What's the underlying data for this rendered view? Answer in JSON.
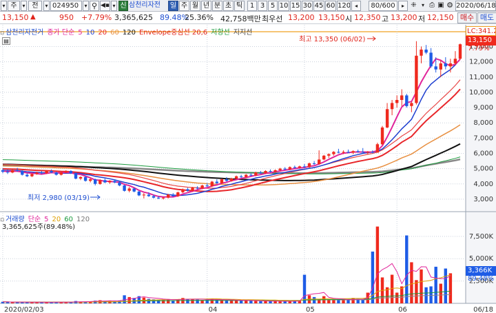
{
  "toolbar": {
    "menu1": "주",
    "menu2": "전",
    "code": "024950",
    "tag": "신",
    "name": "삼천리자전",
    "period": [
      "일",
      "주",
      "월",
      "년",
      "분",
      "초",
      "틱"
    ],
    "ticks": [
      "1",
      "3",
      "5",
      "10",
      "15",
      "30",
      "45",
      "60",
      "120"
    ],
    "count": "80/600",
    "date": "2020/06/18"
  },
  "quote": {
    "price": "13,150",
    "arrow": "▲",
    "change": "950",
    "pct": "+7.79%",
    "volume": "3,365,625",
    "vol_ratio": "89.48%",
    "turnover": "25.36%",
    "amount": "42,758백만",
    "best_label": "최우선",
    "ask": "13,200",
    "bid": "13,150",
    "open_label": "시",
    "open": "12,350",
    "high_label": "고",
    "high": "13,200",
    "low_label": "저",
    "low": "12,150",
    "buy": "매수",
    "sell": "매도"
  },
  "legend": {
    "name": "삼천리자전거",
    "ma_label": "종가 단순",
    "ma": [
      "5",
      "10",
      "20",
      "60",
      "120"
    ],
    "envelope": "Envelope중심선 20,6",
    "resist": "저항선",
    "support": "지지선"
  },
  "price_panel": {
    "lc_label": "LC:341.2",
    "last_price": "13,150",
    "last_pct": "7.79%",
    "high_note": "최고 13,350 (06/02)",
    "low_note": "최저 2,980 (03/19)",
    "ticks": [
      "13,000",
      "12,000",
      "11,000",
      "10,000",
      "9,000",
      "8,000",
      "7,000",
      "6,000",
      "5,000",
      "4,000",
      "3,000"
    ]
  },
  "vol_panel": {
    "title": "거래량",
    "ma_label": "단순",
    "ma": [
      "5",
      "20",
      "60",
      "120"
    ],
    "current": "3,365,625주(89.48%)",
    "ticks": [
      "7,500K",
      "5,000K",
      "2,500K"
    ],
    "last_vol": "3,366K",
    "last_pct": "89.48%"
  },
  "x_axis": {
    "labels": [
      "2020/02/03",
      "04",
      "05",
      "06",
      "06/18"
    ]
  },
  "chart_data": {
    "type": "candlestick",
    "y_range": [
      2500,
      13700
    ],
    "candles": [
      {
        "d": "02/03",
        "o": 4900,
        "h": 5000,
        "l": 4700,
        "c": 4800
      },
      {
        "d": "02/04",
        "o": 4800,
        "h": 4950,
        "l": 4650,
        "c": 4750
      },
      {
        "d": "02/05",
        "o": 4750,
        "h": 4950,
        "l": 4700,
        "c": 4900
      },
      {
        "d": "02/06",
        "o": 4900,
        "h": 5050,
        "l": 4800,
        "c": 4850
      },
      {
        "d": "02/07",
        "o": 4850,
        "h": 4900,
        "l": 4550,
        "c": 4600
      },
      {
        "d": "02/10",
        "o": 4600,
        "h": 4700,
        "l": 4450,
        "c": 4500
      },
      {
        "d": "02/11",
        "o": 4500,
        "h": 4700,
        "l": 4450,
        "c": 4650
      },
      {
        "d": "02/12",
        "o": 4650,
        "h": 4800,
        "l": 4600,
        "c": 4750
      },
      {
        "d": "02/13",
        "o": 4750,
        "h": 4850,
        "l": 4650,
        "c": 4700
      },
      {
        "d": "02/14",
        "o": 4700,
        "h": 4900,
        "l": 4650,
        "c": 4850
      },
      {
        "d": "02/17",
        "o": 4850,
        "h": 4950,
        "l": 4700,
        "c": 4750
      },
      {
        "d": "02/18",
        "o": 4750,
        "h": 4800,
        "l": 4550,
        "c": 4600
      },
      {
        "d": "02/19",
        "o": 4600,
        "h": 4800,
        "l": 4550,
        "c": 4750
      },
      {
        "d": "02/20",
        "o": 4750,
        "h": 4900,
        "l": 4700,
        "c": 4850
      },
      {
        "d": "02/21",
        "o": 4850,
        "h": 4900,
        "l": 4650,
        "c": 4700
      },
      {
        "d": "02/24",
        "o": 4700,
        "h": 4750,
        "l": 4300,
        "c": 4350
      },
      {
        "d": "02/25",
        "o": 4350,
        "h": 4500,
        "l": 4250,
        "c": 4450
      },
      {
        "d": "02/26",
        "o": 4450,
        "h": 4500,
        "l": 4150,
        "c": 4200
      },
      {
        "d": "02/27",
        "o": 4200,
        "h": 4400,
        "l": 4100,
        "c": 4300
      },
      {
        "d": "02/28",
        "o": 4300,
        "h": 4350,
        "l": 3900,
        "c": 4000
      },
      {
        "d": "03/02",
        "o": 4000,
        "h": 4300,
        "l": 3950,
        "c": 4250
      },
      {
        "d": "03/03",
        "o": 4250,
        "h": 4350,
        "l": 4050,
        "c": 4100
      },
      {
        "d": "03/04",
        "o": 4100,
        "h": 4250,
        "l": 4000,
        "c": 4200
      },
      {
        "d": "03/05",
        "o": 4200,
        "h": 4300,
        "l": 4050,
        "c": 4100
      },
      {
        "d": "03/06",
        "o": 4100,
        "h": 4150,
        "l": 3850,
        "c": 3900
      },
      {
        "d": "03/09",
        "o": 3900,
        "h": 3950,
        "l": 3500,
        "c": 3550
      },
      {
        "d": "03/10",
        "o": 3550,
        "h": 3800,
        "l": 3450,
        "c": 3700
      },
      {
        "d": "03/11",
        "o": 3700,
        "h": 3750,
        "l": 3450,
        "c": 3500
      },
      {
        "d": "03/12",
        "o": 3500,
        "h": 3550,
        "l": 3200,
        "c": 3250
      },
      {
        "d": "03/13",
        "o": 3250,
        "h": 3400,
        "l": 3050,
        "c": 3300
      },
      {
        "d": "03/16",
        "o": 3300,
        "h": 3450,
        "l": 3150,
        "c": 3200
      },
      {
        "d": "03/17",
        "o": 3200,
        "h": 3300,
        "l": 3050,
        "c": 3100
      },
      {
        "d": "03/18",
        "o": 3100,
        "h": 3200,
        "l": 3000,
        "c": 3050
      },
      {
        "d": "03/19",
        "o": 3050,
        "h": 3150,
        "l": 2980,
        "c": 3100
      },
      {
        "d": "03/20",
        "o": 3100,
        "h": 3350,
        "l": 3050,
        "c": 3300
      },
      {
        "d": "03/23",
        "o": 3300,
        "h": 3400,
        "l": 3150,
        "c": 3200
      },
      {
        "d": "03/24",
        "o": 3200,
        "h": 3500,
        "l": 3150,
        "c": 3450
      },
      {
        "d": "03/25",
        "o": 3450,
        "h": 3700,
        "l": 3400,
        "c": 3650
      },
      {
        "d": "03/26",
        "o": 3650,
        "h": 3750,
        "l": 3500,
        "c": 3550
      },
      {
        "d": "03/27",
        "o": 3550,
        "h": 3800,
        "l": 3500,
        "c": 3750
      },
      {
        "d": "03/30",
        "o": 3750,
        "h": 3850,
        "l": 3650,
        "c": 3700
      },
      {
        "d": "03/31",
        "o": 3700,
        "h": 3950,
        "l": 3650,
        "c": 3900
      },
      {
        "d": "04/01",
        "o": 3900,
        "h": 4050,
        "l": 3800,
        "c": 3850
      },
      {
        "d": "04/02",
        "o": 3850,
        "h": 4200,
        "l": 3800,
        "c": 4150
      },
      {
        "d": "04/03",
        "o": 4150,
        "h": 4300,
        "l": 4000,
        "c": 4050
      },
      {
        "d": "04/06",
        "o": 4050,
        "h": 4350,
        "l": 4000,
        "c": 4300
      },
      {
        "d": "04/07",
        "o": 4300,
        "h": 4450,
        "l": 4150,
        "c": 4200
      },
      {
        "d": "04/08",
        "o": 4200,
        "h": 4400,
        "l": 4150,
        "c": 4350
      },
      {
        "d": "04/09",
        "o": 4350,
        "h": 4550,
        "l": 4300,
        "c": 4500
      },
      {
        "d": "04/10",
        "o": 4500,
        "h": 4600,
        "l": 4400,
        "c": 4450
      },
      {
        "d": "04/13",
        "o": 4450,
        "h": 4650,
        "l": 4400,
        "c": 4600
      },
      {
        "d": "04/14",
        "o": 4600,
        "h": 4700,
        "l": 4500,
        "c": 4550
      },
      {
        "d": "04/16",
        "o": 4550,
        "h": 4800,
        "l": 4500,
        "c": 4750
      },
      {
        "d": "04/17",
        "o": 4750,
        "h": 4850,
        "l": 4650,
        "c": 4700
      },
      {
        "d": "04/20",
        "o": 4700,
        "h": 4900,
        "l": 4650,
        "c": 4850
      },
      {
        "d": "04/21",
        "o": 4850,
        "h": 4950,
        "l": 4750,
        "c": 4800
      },
      {
        "d": "04/22",
        "o": 4800,
        "h": 4950,
        "l": 4750,
        "c": 4900
      },
      {
        "d": "04/23",
        "o": 4900,
        "h": 5050,
        "l": 4850,
        "c": 5000
      },
      {
        "d": "04/24",
        "o": 5000,
        "h": 5100,
        "l": 4900,
        "c": 4950
      },
      {
        "d": "04/27",
        "o": 4950,
        "h": 5150,
        "l": 4900,
        "c": 5100
      },
      {
        "d": "04/28",
        "o": 5100,
        "h": 5200,
        "l": 5000,
        "c": 5050
      },
      {
        "d": "04/29",
        "o": 5050,
        "h": 5200,
        "l": 5000,
        "c": 5150
      },
      {
        "d": "05/04",
        "o": 5150,
        "h": 5300,
        "l": 5050,
        "c": 5100
      },
      {
        "d": "05/06",
        "o": 5100,
        "h": 5400,
        "l": 5050,
        "c": 5350
      },
      {
        "d": "05/07",
        "o": 5350,
        "h": 5500,
        "l": 5250,
        "c": 5300
      },
      {
        "d": "05/08",
        "o": 5300,
        "h": 6200,
        "l": 5250,
        "c": 5600
      },
      {
        "d": "05/11",
        "o": 5600,
        "h": 5900,
        "l": 5550,
        "c": 5850
      },
      {
        "d": "05/12",
        "o": 5850,
        "h": 6000,
        "l": 5700,
        "c": 5950
      },
      {
        "d": "05/13",
        "o": 5950,
        "h": 6150,
        "l": 5850,
        "c": 6100
      },
      {
        "d": "05/14",
        "o": 6100,
        "h": 6300,
        "l": 6000,
        "c": 6050
      },
      {
        "d": "05/15",
        "o": 6050,
        "h": 6200,
        "l": 5950,
        "c": 6100
      },
      {
        "d": "05/18",
        "o": 6100,
        "h": 6250,
        "l": 6000,
        "c": 6050
      },
      {
        "d": "05/19",
        "o": 6050,
        "h": 6200,
        "l": 5950,
        "c": 6150
      },
      {
        "d": "05/20",
        "o": 6150,
        "h": 6250,
        "l": 6050,
        "c": 6100
      },
      {
        "d": "05/21",
        "o": 6100,
        "h": 6350,
        "l": 6050,
        "c": 6050
      },
      {
        "d": "05/22",
        "o": 6050,
        "h": 6150,
        "l": 5950,
        "c": 6100
      },
      {
        "d": "05/25",
        "o": 6100,
        "h": 6200,
        "l": 6000,
        "c": 6050
      },
      {
        "d": "05/26",
        "o": 6050,
        "h": 6700,
        "l": 6050,
        "c": 6600
      },
      {
        "d": "05/27",
        "o": 6600,
        "h": 7800,
        "l": 6550,
        "c": 7700
      },
      {
        "d": "05/28",
        "o": 7700,
        "h": 9300,
        "l": 7650,
        "c": 8900
      },
      {
        "d": "05/29",
        "o": 8900,
        "h": 9500,
        "l": 8500,
        "c": 9300
      },
      {
        "d": "06/01",
        "o": 9300,
        "h": 9800,
        "l": 9000,
        "c": 9500
      },
      {
        "d": "06/02",
        "o": 9500,
        "h": 10200,
        "l": 9100,
        "c": 9800
      },
      {
        "d": "06/03",
        "o": 9800,
        "h": 9900,
        "l": 9000,
        "c": 9100
      },
      {
        "d": "06/04",
        "o": 9100,
        "h": 9400,
        "l": 8700,
        "c": 9300
      },
      {
        "d": "06/05",
        "o": 9300,
        "h": 13350,
        "l": 9200,
        "c": 12400
      },
      {
        "d": "06/08",
        "o": 12400,
        "h": 13000,
        "l": 11900,
        "c": 12800
      },
      {
        "d": "06/09",
        "o": 12800,
        "h": 13100,
        "l": 12500,
        "c": 12600
      },
      {
        "d": "06/10",
        "o": 12600,
        "h": 12900,
        "l": 11600,
        "c": 11700
      },
      {
        "d": "06/11",
        "o": 11700,
        "h": 12300,
        "l": 11300,
        "c": 11500
      },
      {
        "d": "06/12",
        "o": 11500,
        "h": 12100,
        "l": 11000,
        "c": 11900
      },
      {
        "d": "06/15",
        "o": 11900,
        "h": 12300,
        "l": 11500,
        "c": 11700
      },
      {
        "d": "06/16",
        "o": 11700,
        "h": 12200,
        "l": 11300,
        "c": 11900
      },
      {
        "d": "06/17",
        "o": 11900,
        "h": 12700,
        "l": 11800,
        "c": 12200
      },
      {
        "d": "06/18",
        "o": 12200,
        "h": 13200,
        "l": 12150,
        "c": 13150
      }
    ],
    "volumes": [
      180,
      150,
      120,
      140,
      160,
      130,
      110,
      120,
      130,
      140,
      120,
      150,
      130,
      120,
      150,
      260,
      200,
      180,
      220,
      300,
      350,
      280,
      260,
      240,
      300,
      900,
      700,
      600,
      800,
      650,
      500,
      450,
      400,
      420,
      480,
      350,
      400,
      600,
      500,
      450,
      420,
      380,
      400,
      500,
      420,
      380,
      350,
      330,
      360,
      300,
      320,
      280,
      260,
      250,
      240,
      260,
      230,
      220,
      200,
      250,
      300,
      280,
      3200,
      900,
      700,
      500,
      800,
      450,
      400,
      420,
      380,
      350,
      600,
      500,
      420,
      1200,
      5800,
      8600,
      2900,
      1800,
      3200,
      1200,
      1900,
      7600,
      4600,
      2600,
      3800,
      1800,
      1900,
      4100,
      2200,
      3900,
      3366
    ],
    "vol_max": 8800
  },
  "colors": {
    "up": "#ef2a1e",
    "down": "#1e5ce6",
    "ma5": "#e0249a",
    "ma10": "#1e3fd0",
    "ma20": "#e8262a",
    "ma60": "#e88f40",
    "ma120": "#111111",
    "ma240": "#1a9a3d",
    "grid": "#c9d0dc"
  }
}
